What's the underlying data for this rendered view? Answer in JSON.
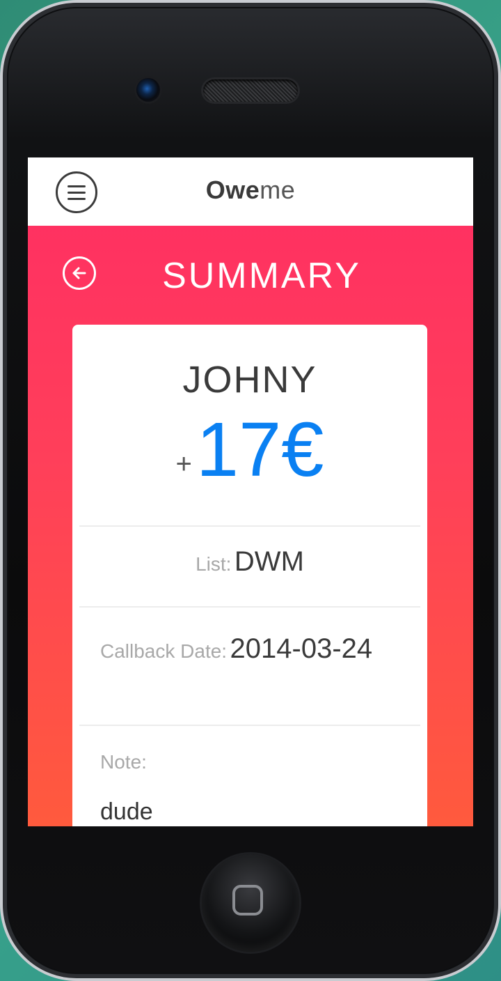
{
  "app": {
    "title_bold": "Owe",
    "title_light": "me"
  },
  "page": {
    "title": "SUMMARY"
  },
  "summary": {
    "person": "JOHNY",
    "amount_sign": "+",
    "amount": "17€",
    "list_label": "List:",
    "list_value": "DWM",
    "callback_label": "Callback Date:",
    "callback_value": "2014-03-24",
    "note_label": "Note:",
    "note_value": "dude"
  },
  "colors": {
    "accent_top": "#ff2d63",
    "accent_bottom": "#ff5a3d",
    "amount": "#0a80f2"
  },
  "icons": {
    "menu": "menu-icon",
    "back": "back-arrow-icon",
    "home": "home-button-icon"
  }
}
